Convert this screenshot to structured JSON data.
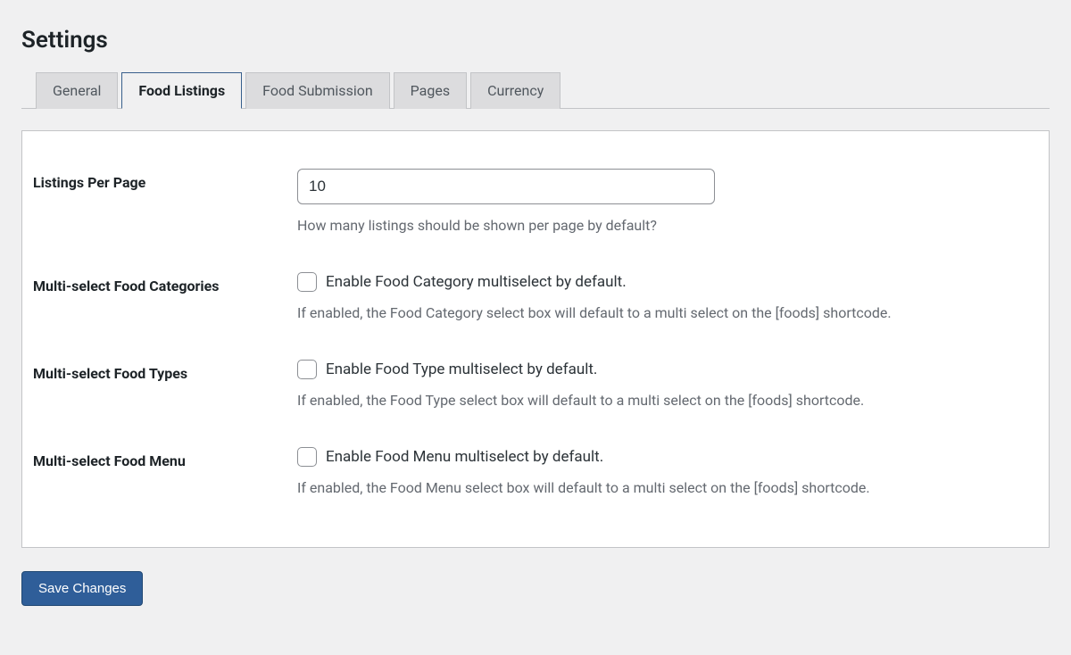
{
  "page_title": "Settings",
  "tabs": {
    "general": "General",
    "food_listings": "Food Listings",
    "food_submission": "Food Submission",
    "pages": "Pages",
    "currency": "Currency"
  },
  "active_tab": "food_listings",
  "fields": {
    "listings_per_page": {
      "label": "Listings Per Page",
      "value": "10",
      "help": "How many listings should be shown per page by default?"
    },
    "multi_categories": {
      "label": "Multi-select Food Categories",
      "checkbox_label": "Enable Food Category multiselect by default.",
      "help": "If enabled, the Food Category select box will default to a multi select on the [foods] shortcode."
    },
    "multi_types": {
      "label": "Multi-select Food Types",
      "checkbox_label": "Enable Food Type multiselect by default.",
      "help": "If enabled, the Food Type select box will default to a multi select on the [foods] shortcode."
    },
    "multi_menu": {
      "label": "Multi-select Food Menu",
      "checkbox_label": "Enable Food Menu multiselect by default.",
      "help": "If enabled, the Food Menu select box will default to a multi select on the [foods] shortcode."
    }
  },
  "save_button": "Save Changes"
}
